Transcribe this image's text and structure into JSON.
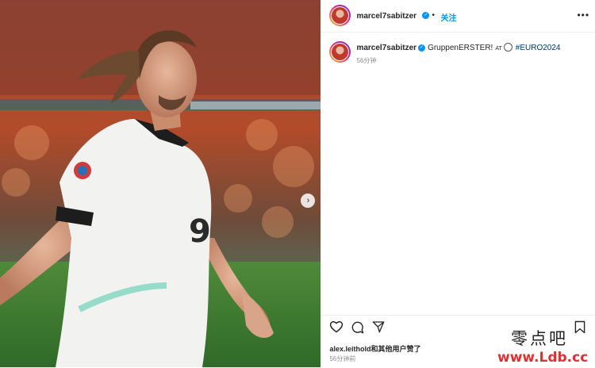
{
  "post": {
    "media": {
      "description_icon": "photo",
      "next_icon": "chevron-right-icon"
    },
    "header": {
      "username": "marcel7sabitzer",
      "separator": "•",
      "follow_label": "关注",
      "more_icon": "more-icon"
    },
    "caption": {
      "username": "marcel7sabitzer",
      "text": "GruppenERSTER!",
      "at_label": "AT",
      "hashtag": "#EURO2024",
      "time": "56分钟"
    },
    "actions": {
      "like_icon": "heart-icon",
      "comment_icon": "comment-icon",
      "share_icon": "send-icon",
      "save_icon": "bookmark-icon",
      "likes_text": "alex.leithold和其他用户赞了",
      "posted_time": "56分钟前"
    }
  },
  "watermark": {
    "chinese": "零点吧",
    "site": "www.Ldb.cc"
  },
  "colors": {
    "accent_blue": "#0095f6",
    "hashtag": "#00376b",
    "watermark_red": "#e03131"
  }
}
